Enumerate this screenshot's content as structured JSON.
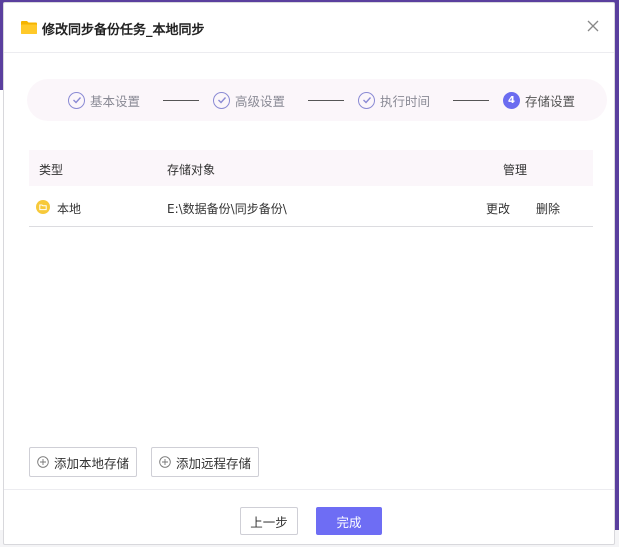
{
  "dialog": {
    "title": "修改同步备份任务_本地同步",
    "close_icon": "close-icon",
    "folder_icon": "folder-icon",
    "folder_color": "#f5b400"
  },
  "steps": [
    {
      "label": "基本设置",
      "state": "done",
      "icon": "check-circle-icon"
    },
    {
      "label": "高级设置",
      "state": "done",
      "icon": "check-circle-icon"
    },
    {
      "label": "执行时间",
      "state": "done",
      "icon": "check-circle-icon"
    },
    {
      "label": "存储设置",
      "state": "current",
      "number": "4"
    }
  ],
  "table": {
    "headers": {
      "type": "类型",
      "target": "存储对象",
      "manage": "管理"
    },
    "rows": [
      {
        "type": "本地",
        "target": "E:\\数据备份\\同步备份\\",
        "edit": "更改",
        "delete": "删除",
        "icon": "local-storage-icon"
      }
    ]
  },
  "actions": {
    "add_local": "添加本地存储",
    "add_remote": "添加远程存储",
    "prev": "上一步",
    "done": "完成"
  },
  "colors": {
    "accent": "#6e6df4",
    "step_border": "#8a8ad4",
    "header_bg": "#fbf6fa"
  }
}
